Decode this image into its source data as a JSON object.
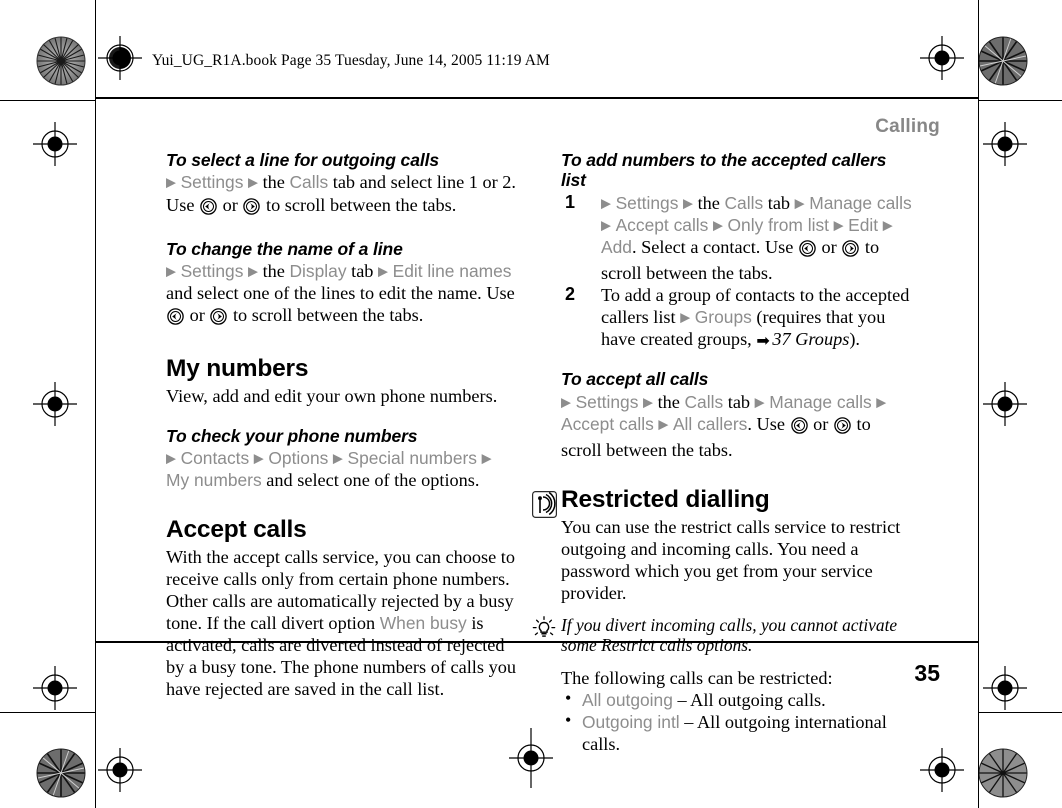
{
  "page": {
    "filestamp": "Yui_UG_R1A.book  Page 35  Tuesday, June 14, 2005  11:19 AM",
    "running_head": "Calling",
    "folio": "35",
    "head_color": "#878787",
    "ui_term_color": "#8d8d8d"
  },
  "left_column": {
    "sub1": {
      "heading": "To select a line for outgoing calls",
      "line1_a": "▶",
      "line1_b": "Settings",
      "line1_c": "▶",
      "line1_d": "the",
      "line1_e": "Calls",
      "line1_f": "tab and select line 1 or 2. Use",
      "line2_or": "or",
      "line2_tail": "to scroll between the tabs."
    },
    "sub2": {
      "heading": "To change the name of a line",
      "a": "▶",
      "b": "Settings",
      "c": "▶",
      "d": "the",
      "e": "Display",
      "f": "tab",
      "g": "▶",
      "h": "Edit line names",
      "i": "and select one of the lines to edit the name. Use",
      "j": "or",
      "k": "to scroll between the tabs."
    },
    "sec1": {
      "heading": "My numbers",
      "body": "View, add and edit your own phone numbers."
    },
    "sub3": {
      "heading": "To check your phone numbers",
      "a": "▶",
      "b": "Contacts",
      "c": "▶",
      "d": "Options",
      "e": "▶",
      "f": "Special numbers",
      "g": "▶",
      "h": "My numbers",
      "i": "and select one of the options."
    },
    "sec2": {
      "heading": "Accept calls",
      "body_a": "With the accept calls service, you can choose to receive calls only from certain phone numbers. Other calls are automatically rejected by a busy tone. If the call divert option",
      "body_ui": "When busy",
      "body_b": "is activated, calls are diverted instead of rejected by a busy tone. The phone numbers of calls you have rejected are saved in the call list."
    }
  },
  "right_column": {
    "sub1": {
      "heading": "To add numbers to the accepted callers list",
      "step1": {
        "num": "1",
        "a": "▶",
        "b": "Settings",
        "c": "▶",
        "d": "the",
        "e": "Calls",
        "f": "tab",
        "g": "▶",
        "h": "Manage calls",
        "i": "▶",
        "j": "Accept calls",
        "k": "▶",
        "l": "Only from list",
        "m": "▶",
        "n": "Edit",
        "o": "▶",
        "p": "Add",
        "q": ". Select a contact. Use",
        "r": "or",
        "s": "to scroll between the tabs."
      },
      "step2": {
        "num": "2",
        "a": "To add a group of contacts to the accepted callers list",
        "b": "▶",
        "c": "Groups",
        "d": "(requires that you have created groups,",
        "arrow": "➡",
        "xref": "37 Groups",
        "e": ")."
      }
    },
    "sub2": {
      "heading": "To accept all calls",
      "a": "▶",
      "b": "Settings",
      "c": "▶",
      "d": "the",
      "e": "Calls",
      "f": "tab",
      "g": "▶",
      "h": "Manage calls",
      "i": "▶",
      "j": "Accept calls",
      "k": "▶",
      "l": "All callers",
      "m": ". Use",
      "n": "or",
      "o": "to scroll between the tabs."
    },
    "sec1": {
      "heading": "Restricted dialling",
      "icon": "network-signal-icon",
      "body": "You can use the restrict calls service to restrict outgoing and incoming calls. You need a password which you get from your service provider."
    },
    "tip": {
      "icon": "lightbulb-tip-icon",
      "text_a": "If you divert incoming calls, you cannot activate some",
      "text_b": "Restrict calls",
      "text_c": "options."
    },
    "list_intro": "The following calls can be restricted:",
    "bullets": [
      {
        "term": "All outgoing",
        "dash": "–",
        "desc": "All outgoing calls."
      },
      {
        "term": "Outgoing intl",
        "dash": "–",
        "desc": "All outgoing international calls."
      }
    ]
  },
  "icons": {
    "nav_left": "nav-key-left-icon",
    "nav_right": "nav-key-right-icon"
  }
}
